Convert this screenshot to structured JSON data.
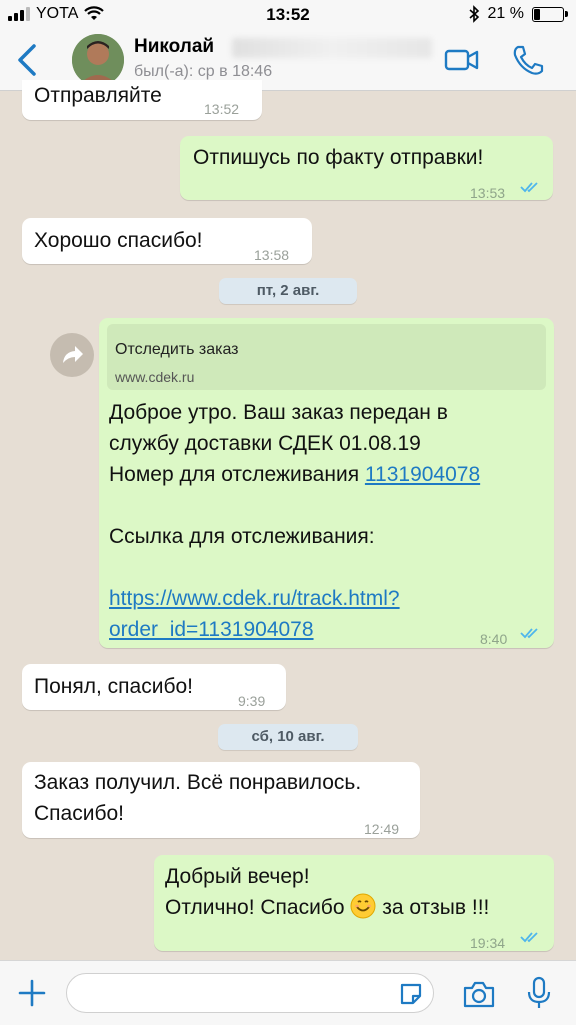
{
  "status_bar": {
    "carrier": "YOTA",
    "time": "13:52",
    "battery": "21 %",
    "battery_level": 0.21
  },
  "header": {
    "contact_name": "Николай",
    "status": "был(-а): ср в 18:46"
  },
  "messages": [
    {
      "text": "Отправляйте",
      "time": "13:52"
    },
    {
      "text": "Отпишусь по факту отправки!",
      "time": "13:53"
    },
    {
      "text": "Хорошо спасибо!",
      "time": "13:58"
    },
    {
      "date": "пт, 2 авг."
    },
    {
      "preview_title": "Отследить заказ",
      "preview_url": "www.cdek.ru",
      "line1": "Доброе утро. Ваш заказ передан в",
      "line2": "службу доставки СДЕК 01.08.19",
      "line3": "Номер для отслеживания ",
      "tracking_number": "1131904078",
      "line4": "Ссылка для отслеживания:",
      "url_line1": "https://www.cdek.ru/track.html?",
      "url_line2": "order_id=1131904078",
      "time": "8:40"
    },
    {
      "text": "Понял, спасибо!",
      "time": "9:39"
    },
    {
      "date": "сб, 10 авг."
    },
    {
      "line1": "Заказ получил. Всё понравилось.",
      "line2": "Спасибо!",
      "time": "12:49"
    },
    {
      "line1": "Добрый вечер!",
      "line2_a": "Отлично! Спасибо ",
      "line2_b": " за отзыв !!!",
      "time": "19:34"
    }
  ],
  "colors": {
    "accent": "#1e7ac3",
    "outgoing_bubble": "#dcf8c6",
    "incoming_bubble": "#ffffff",
    "read_ticks": "#4fb6ec"
  },
  "icons": [
    "back-icon",
    "video-call-icon",
    "phone-icon",
    "forward-icon",
    "plus-icon",
    "sticker-icon",
    "camera-icon",
    "mic-icon",
    "double-check-icon",
    "smile-emoji-icon"
  ]
}
